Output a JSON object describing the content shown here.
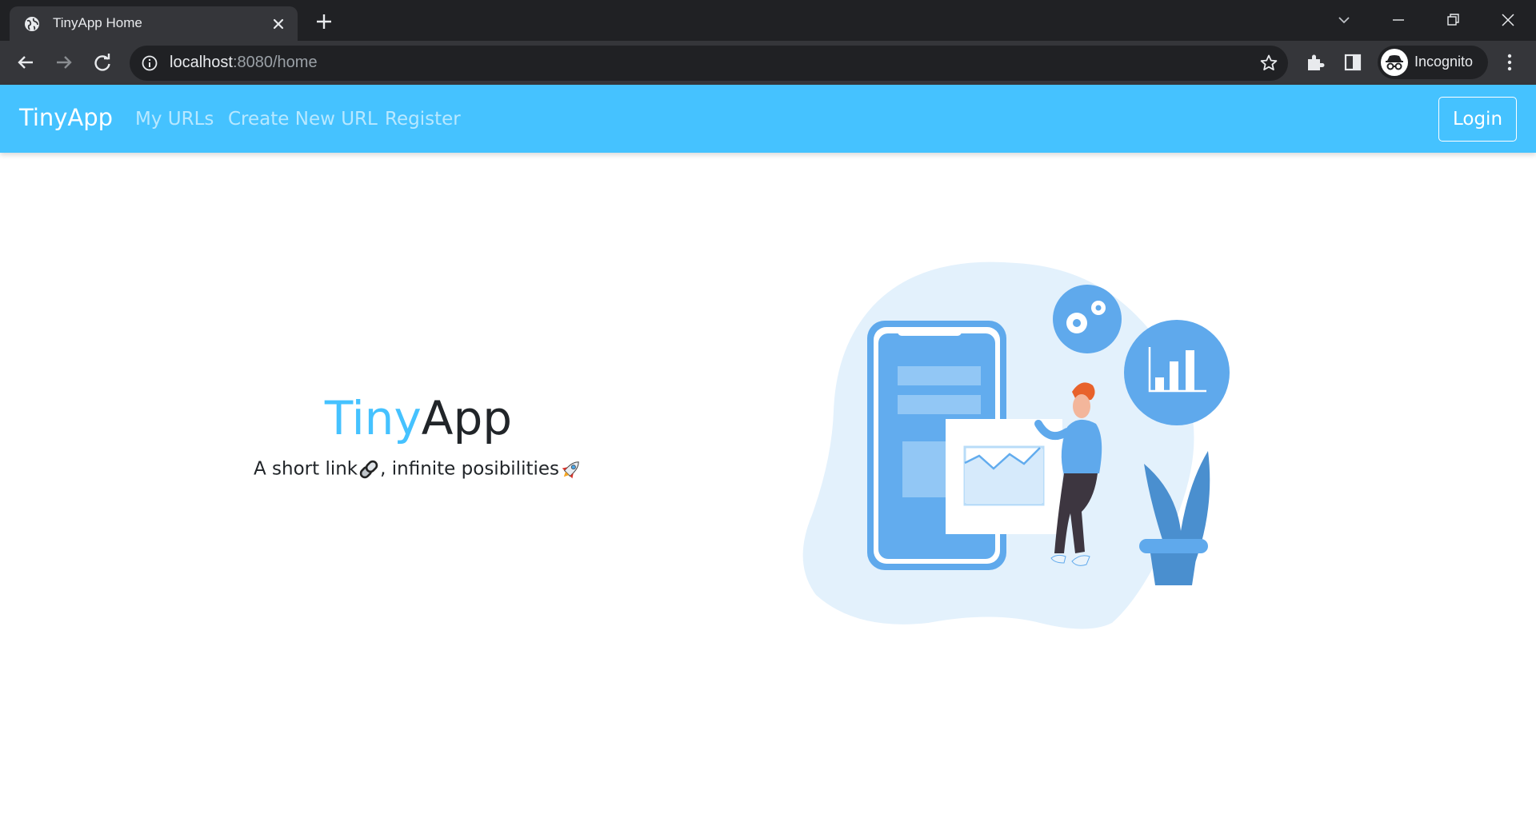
{
  "browser": {
    "tab_title": "TinyApp Home",
    "url_host": "localhost",
    "url_rest": ":8080/home",
    "profile_label": "Incognito"
  },
  "navbar": {
    "brand": "TinyApp",
    "links": [
      "My URLs",
      "Create New URL",
      "Register"
    ],
    "login_label": "Login",
    "background_color": "#45c2ff"
  },
  "hero": {
    "title_accent": "Tiny",
    "title_rest": "App",
    "subtitle_part1": "A short link",
    "subtitle_part2": ", infinite posibilities",
    "accent_color": "#45c2ff"
  },
  "icons": {
    "tab_favicon": "globe-icon",
    "tab_close": "close-icon",
    "new_tab": "plus-icon",
    "back": "back-arrow-icon",
    "forward": "forward-arrow-icon",
    "reload": "reload-icon",
    "site_info": "info-icon",
    "bookmark": "star-icon",
    "extensions": "puzzle-icon",
    "side_panel": "side-panel-icon",
    "incognito": "incognito-icon",
    "menu": "kebab-menu-icon",
    "subtitle_link": "link-emoji-icon",
    "subtitle_rocket": "rocket-emoji-icon"
  }
}
